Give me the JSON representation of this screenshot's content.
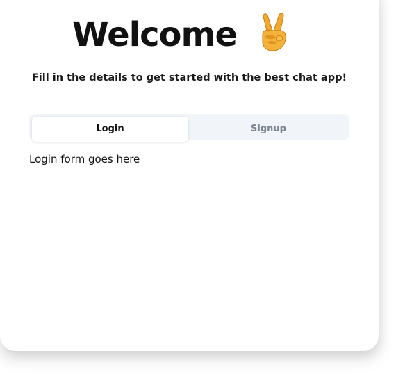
{
  "header": {
    "title": "Welcome",
    "title_icon": "victory-hand-icon",
    "subtitle": "Fill in the details to get started with the best chat app!"
  },
  "tabs": [
    {
      "label": "Login",
      "active": true
    },
    {
      "label": "Signup",
      "active": false
    }
  ],
  "content": {
    "placeholder": "Login form goes here"
  },
  "colors": {
    "active_tab_bg": "#ffffff",
    "tabs_bg": "#f1f4f9",
    "inactive_tab_text": "#7b8490",
    "text": "#111111"
  }
}
